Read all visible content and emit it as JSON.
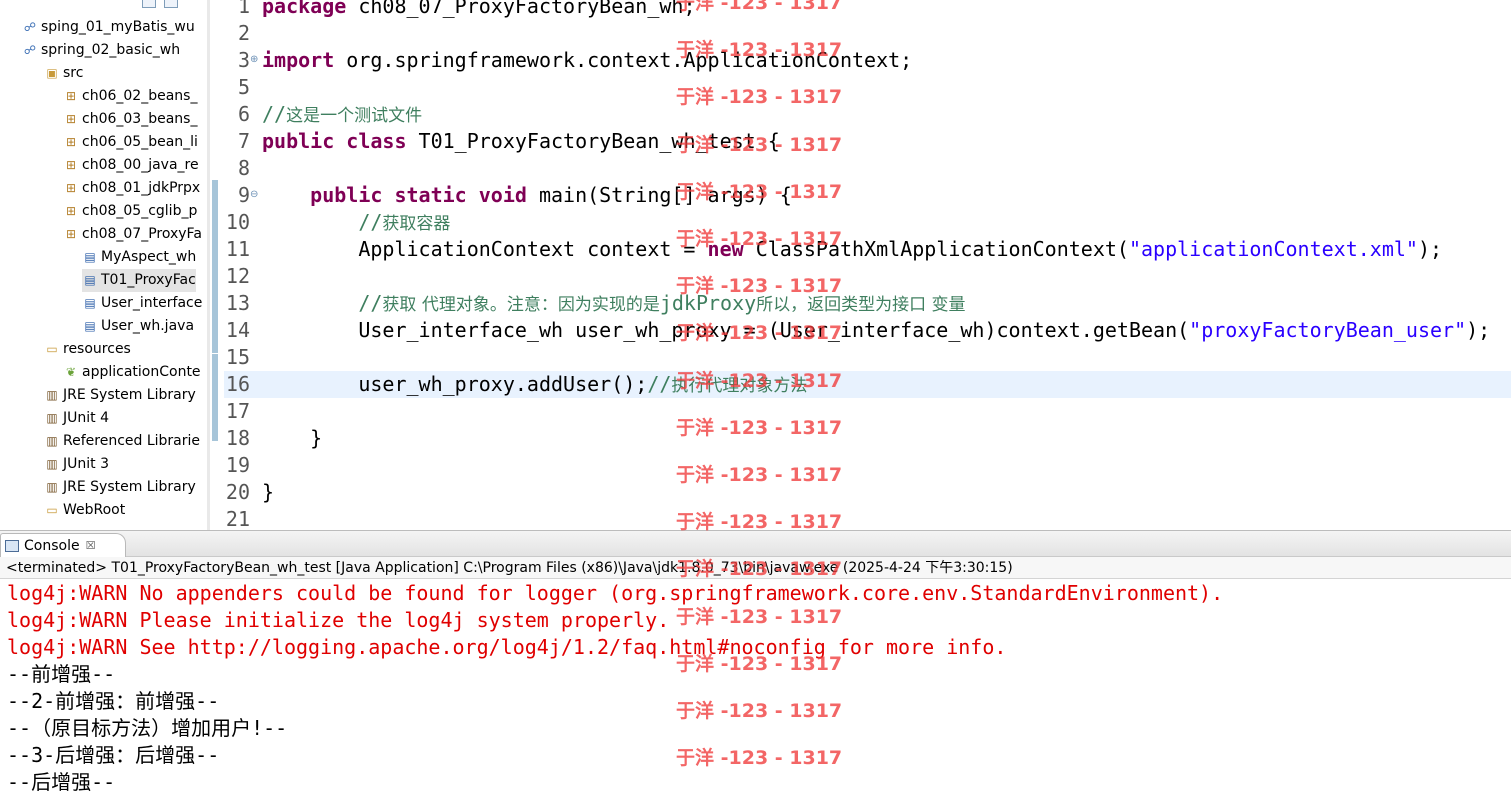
{
  "package_explorer": {
    "items": [
      {
        "label": "sping_01_myBatis_wu",
        "icon": "java-project-icon",
        "depth": 1
      },
      {
        "label": "spring_02_basic_wh",
        "icon": "java-project-icon",
        "depth": 1
      },
      {
        "label": "src",
        "icon": "source-folder-icon",
        "depth": 2
      },
      {
        "label": "ch06_02_beans_",
        "icon": "package-icon",
        "depth": 3
      },
      {
        "label": "ch06_03_beans_",
        "icon": "package-icon",
        "depth": 3
      },
      {
        "label": "ch06_05_bean_li",
        "icon": "package-icon",
        "depth": 3
      },
      {
        "label": "ch08_00_java_re",
        "icon": "package-icon",
        "depth": 3
      },
      {
        "label": "ch08_01_jdkPrpx",
        "icon": "package-icon",
        "depth": 3
      },
      {
        "label": "ch08_05_cglib_p",
        "icon": "package-icon",
        "depth": 3
      },
      {
        "label": "ch08_07_ProxyFa",
        "icon": "package-icon",
        "depth": 3
      },
      {
        "label": "MyAspect_wh",
        "icon": "java-file-icon",
        "depth": 4
      },
      {
        "label": "T01_ProxyFac",
        "icon": "java-file-icon",
        "depth": 4,
        "selected": true
      },
      {
        "label": "User_interface",
        "icon": "java-file-icon",
        "depth": 4
      },
      {
        "label": "User_wh.java",
        "icon": "java-file-icon",
        "depth": 4
      },
      {
        "label": "resources",
        "icon": "folder-icon",
        "depth": 2
      },
      {
        "label": "applicationConte",
        "icon": "xml-file-icon",
        "depth": 3
      },
      {
        "label": "JRE System Library",
        "icon": "library-icon",
        "depth": 2
      },
      {
        "label": "JUnit 4",
        "icon": "library-icon",
        "depth": 2
      },
      {
        "label": "Referenced Librarie",
        "icon": "library-icon",
        "depth": 2
      },
      {
        "label": "JUnit 3",
        "icon": "library-icon",
        "depth": 2
      },
      {
        "label": "JRE System Library",
        "icon": "library-icon",
        "depth": 2
      },
      {
        "label": "WebRoot",
        "icon": "folder-icon",
        "depth": 2
      }
    ]
  },
  "editor": {
    "current_line": 16,
    "lines": [
      {
        "n": "1",
        "tokens": [
          {
            "t": "package",
            "c": "kw"
          },
          {
            "t": " ch08_07_ProxyFactoryBean_wh;",
            "c": ""
          }
        ]
      },
      {
        "n": "2",
        "tokens": []
      },
      {
        "n": "3",
        "fold": "⊕",
        "tokens": [
          {
            "t": "import",
            "c": "kw"
          },
          {
            "t": " org.springframework.context.ApplicationContext;",
            "c": ""
          }
        ]
      },
      {
        "n": "5",
        "tokens": []
      },
      {
        "n": "6",
        "tokens": [
          {
            "t": "//",
            "c": "cmt-mono"
          },
          {
            "t": "这是一个测试文件",
            "c": "cmt"
          }
        ]
      },
      {
        "n": "7",
        "tokens": [
          {
            "t": "public",
            "c": "kw"
          },
          {
            "t": " ",
            "c": ""
          },
          {
            "t": "class",
            "c": "kw"
          },
          {
            "t": " T01_ProxyFactoryBean_wh_test {",
            "c": ""
          }
        ]
      },
      {
        "n": "8",
        "tokens": []
      },
      {
        "n": "9",
        "fold": "⊖",
        "tokens": [
          {
            "t": "    ",
            "c": ""
          },
          {
            "t": "public",
            "c": "kw"
          },
          {
            "t": " ",
            "c": ""
          },
          {
            "t": "static",
            "c": "kw"
          },
          {
            "t": " ",
            "c": ""
          },
          {
            "t": "void",
            "c": "kw"
          },
          {
            "t": " main(String[] args) {",
            "c": ""
          }
        ]
      },
      {
        "n": "10",
        "tokens": [
          {
            "t": "        //",
            "c": "cmt-mono"
          },
          {
            "t": "获取容器",
            "c": "cmt"
          }
        ]
      },
      {
        "n": "11",
        "tokens": [
          {
            "t": "        ApplicationContext context = ",
            "c": ""
          },
          {
            "t": "new",
            "c": "kw"
          },
          {
            "t": " ClassPathXmlApplicationContext(",
            "c": ""
          },
          {
            "t": "\"applicationContext.xml\"",
            "c": "str"
          },
          {
            "t": ");",
            "c": ""
          }
        ]
      },
      {
        "n": "12",
        "tokens": []
      },
      {
        "n": "13",
        "tokens": [
          {
            "t": "        //",
            "c": "cmt-mono"
          },
          {
            "t": "获取 代理对象。注意：因为实现的是",
            "c": "cmt"
          },
          {
            "t": "jdkProxy",
            "c": "cmt-mono"
          },
          {
            "t": "所以，返回类型为接口 变量",
            "c": "cmt"
          }
        ]
      },
      {
        "n": "14",
        "tokens": [
          {
            "t": "        User_interface_wh user_wh_proxy = (User_interface_wh)context.getBean(",
            "c": ""
          },
          {
            "t": "\"proxyFactoryBean_user\"",
            "c": "str"
          },
          {
            "t": ");",
            "c": ""
          }
        ]
      },
      {
        "n": "15",
        "tokens": []
      },
      {
        "n": "16",
        "tokens": [
          {
            "t": "        user_wh_proxy.addUser();",
            "c": ""
          },
          {
            "t": "//",
            "c": "cmt-mono"
          },
          {
            "t": "执行代理对象方法",
            "c": "cmt"
          }
        ]
      },
      {
        "n": "17",
        "tokens": []
      },
      {
        "n": "18",
        "tokens": [
          {
            "t": "    }",
            "c": ""
          }
        ]
      },
      {
        "n": "19",
        "tokens": []
      },
      {
        "n": "20",
        "tokens": [
          {
            "t": "}",
            "c": ""
          }
        ]
      },
      {
        "n": "21",
        "tokens": []
      }
    ]
  },
  "console": {
    "tab_label": "Console",
    "tab_close": "☒",
    "status": "<terminated> T01_ProxyFactoryBean_wh_test [Java Application] C:\\Program Files (x86)\\Java\\jdk1.8.0_73\\bin\\javaw.exe (2025-4-24 下午3:30:15)",
    "lines": [
      {
        "text": "log4j:WARN No appenders could be found for logger (org.springframework.core.env.StandardEnvironment).",
        "kind": "err"
      },
      {
        "text": "log4j:WARN Please initialize the log4j system properly.",
        "kind": "err"
      },
      {
        "text": "log4j:WARN See http://logging.apache.org/log4j/1.2/faq.html#noconfig for more info.",
        "kind": "err"
      },
      {
        "text": "--前增强--",
        "kind": "out"
      },
      {
        "text": "--2-前增强：前增强--",
        "kind": "out"
      },
      {
        "text": "--（原目标方法）增加用户!--",
        "kind": "out"
      },
      {
        "text": "--3-后增强：后增强--",
        "kind": "out"
      },
      {
        "text": "--后增强--",
        "kind": "out"
      }
    ]
  },
  "watermark": {
    "text": "于洋 -123 - 1317",
    "color": "#f03c3c"
  }
}
